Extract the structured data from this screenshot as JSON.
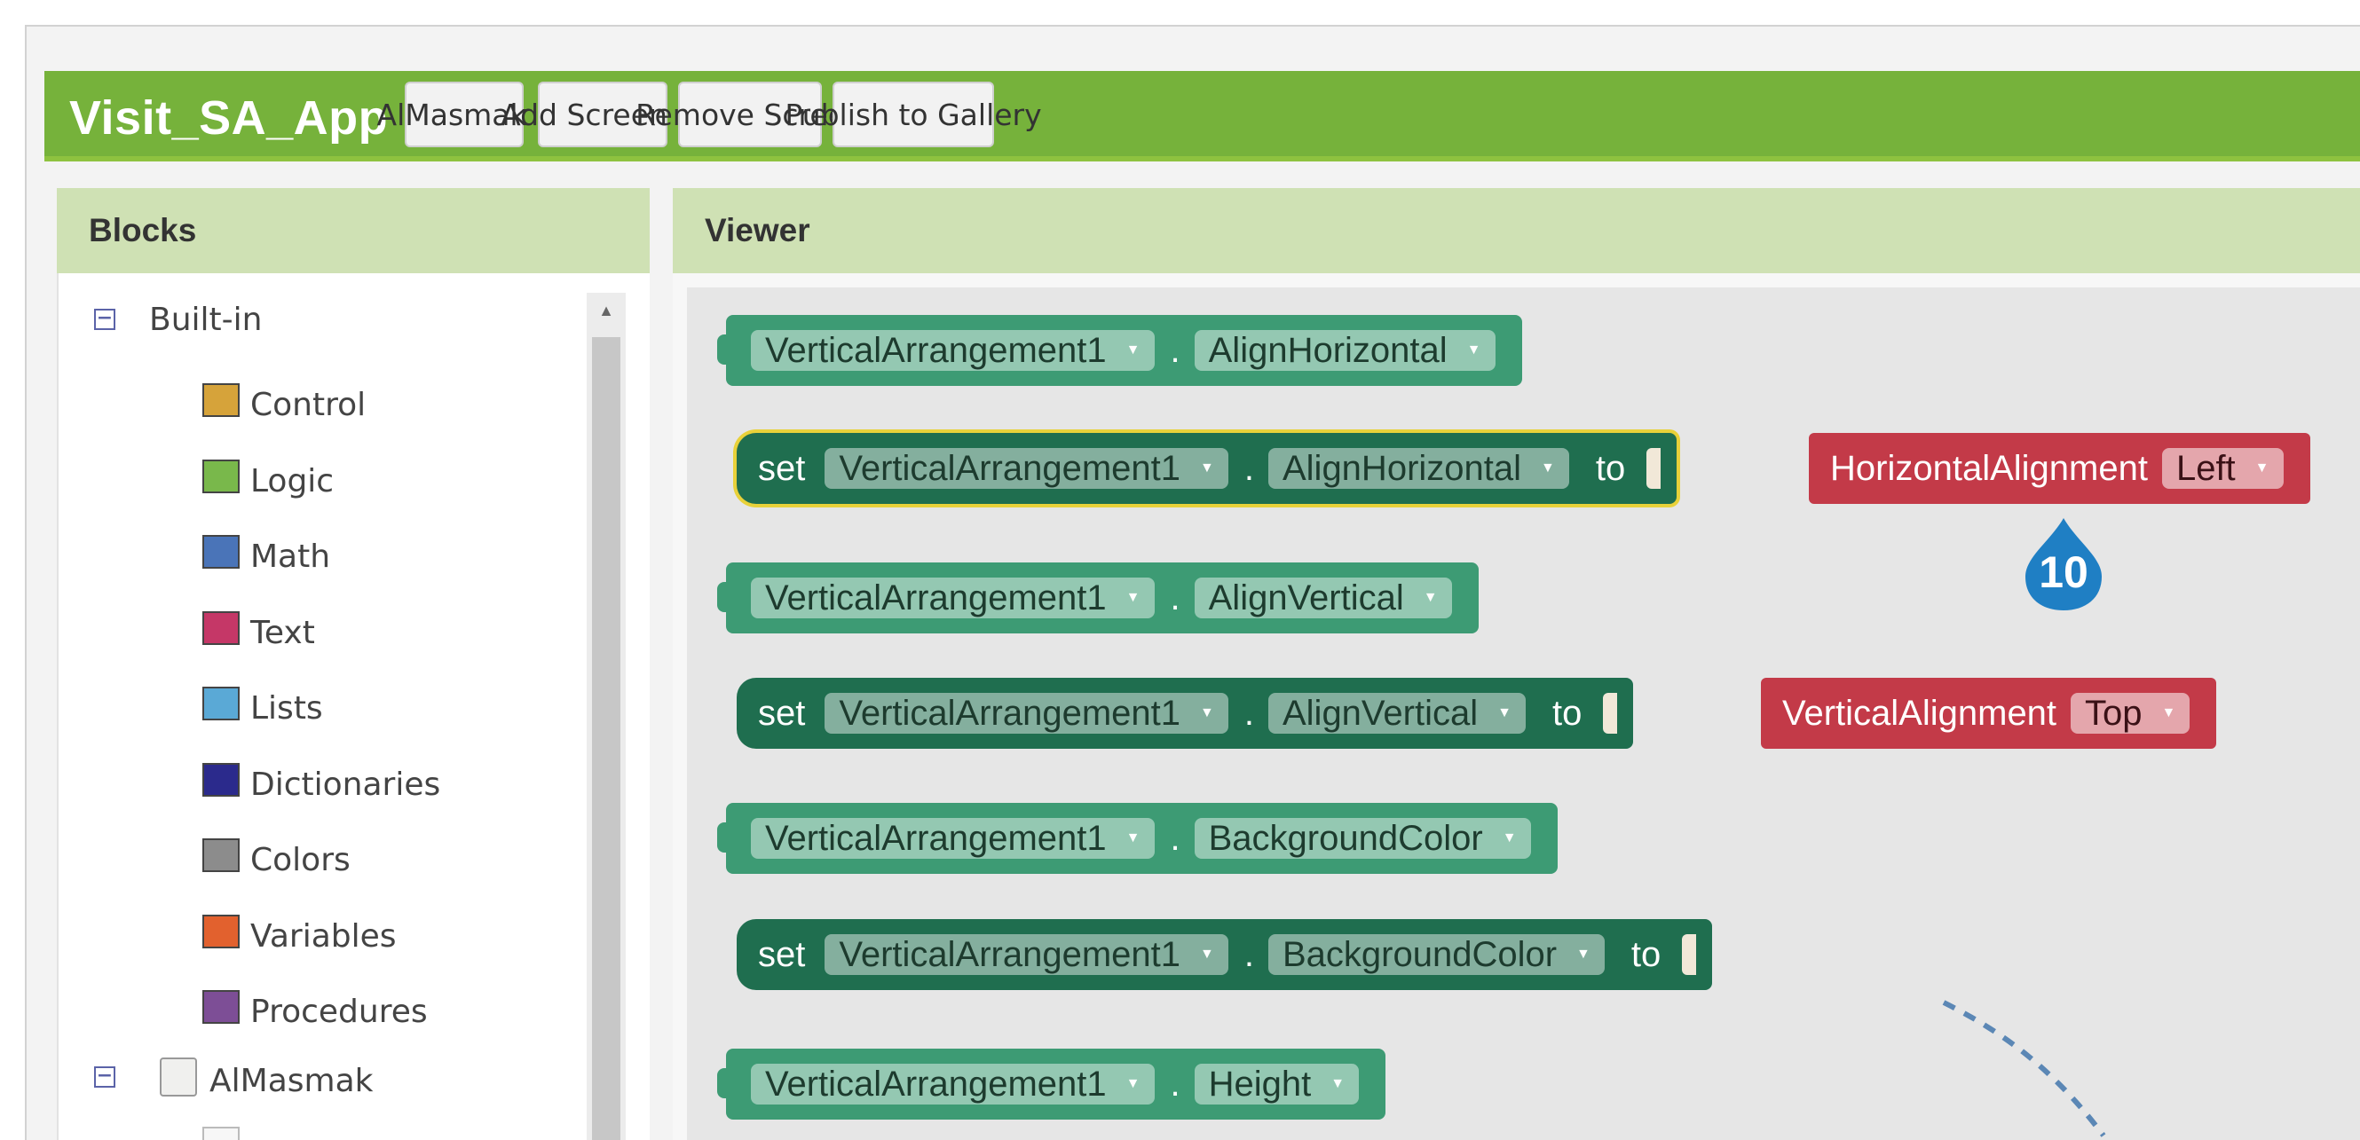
{
  "app": {
    "title": "Visit_SA_App"
  },
  "toolbar": {
    "screen_select": "AlMasmak",
    "add_screen": "Add Screen ...",
    "remove_screen": "Remove Screen",
    "publish": "Publish to Gallery"
  },
  "blocks_panel": {
    "title": "Blocks",
    "builtin_label": "Built-in",
    "toggle_symbol": "⊟",
    "categories": [
      {
        "label": "Control",
        "color": "#d6a33a"
      },
      {
        "label": "Logic",
        "color": "#79b84b"
      },
      {
        "label": "Math",
        "color": "#4a74b8"
      },
      {
        "label": "Text",
        "color": "#c53767"
      },
      {
        "label": "Lists",
        "color": "#5aa9d6"
      },
      {
        "label": "Dictionaries",
        "color": "#2b2a8c"
      },
      {
        "label": "Colors",
        "color": "#8c8c8c"
      },
      {
        "label": "Variables",
        "color": "#e2612e"
      },
      {
        "label": "Procedures",
        "color": "#7d4e96"
      }
    ],
    "screen_node": "AlMasmak"
  },
  "viewer": {
    "title": "Viewer",
    "set_keyword": "set",
    "to_keyword": "to",
    "dot": ".",
    "blocks": [
      {
        "kind": "getter",
        "component": "VerticalArrangement1",
        "property": "AlignHorizontal"
      },
      {
        "kind": "setter",
        "component": "VerticalArrangement1",
        "property": "AlignHorizontal",
        "value_helper": "HorizontalAlignment",
        "value_option": "Left",
        "selected": true
      },
      {
        "kind": "getter",
        "component": "VerticalArrangement1",
        "property": "AlignVertical"
      },
      {
        "kind": "setter",
        "component": "VerticalArrangement1",
        "property": "AlignVertical",
        "value_helper": "VerticalAlignment",
        "value_option": "Top",
        "selected": false
      },
      {
        "kind": "getter",
        "component": "VerticalArrangement1",
        "property": "BackgroundColor"
      },
      {
        "kind": "setter",
        "component": "VerticalArrangement1",
        "property": "BackgroundColor",
        "selected": false
      },
      {
        "kind": "getter",
        "component": "VerticalArrangement1",
        "property": "Height"
      }
    ],
    "step_badge": "10"
  },
  "colors": {
    "toolbar_green": "#76b23b",
    "getter_green": "#3d9b74",
    "setter_green": "#1f6e4f",
    "helper_red": "#c33a48",
    "badge_blue": "#1f7fc4"
  }
}
